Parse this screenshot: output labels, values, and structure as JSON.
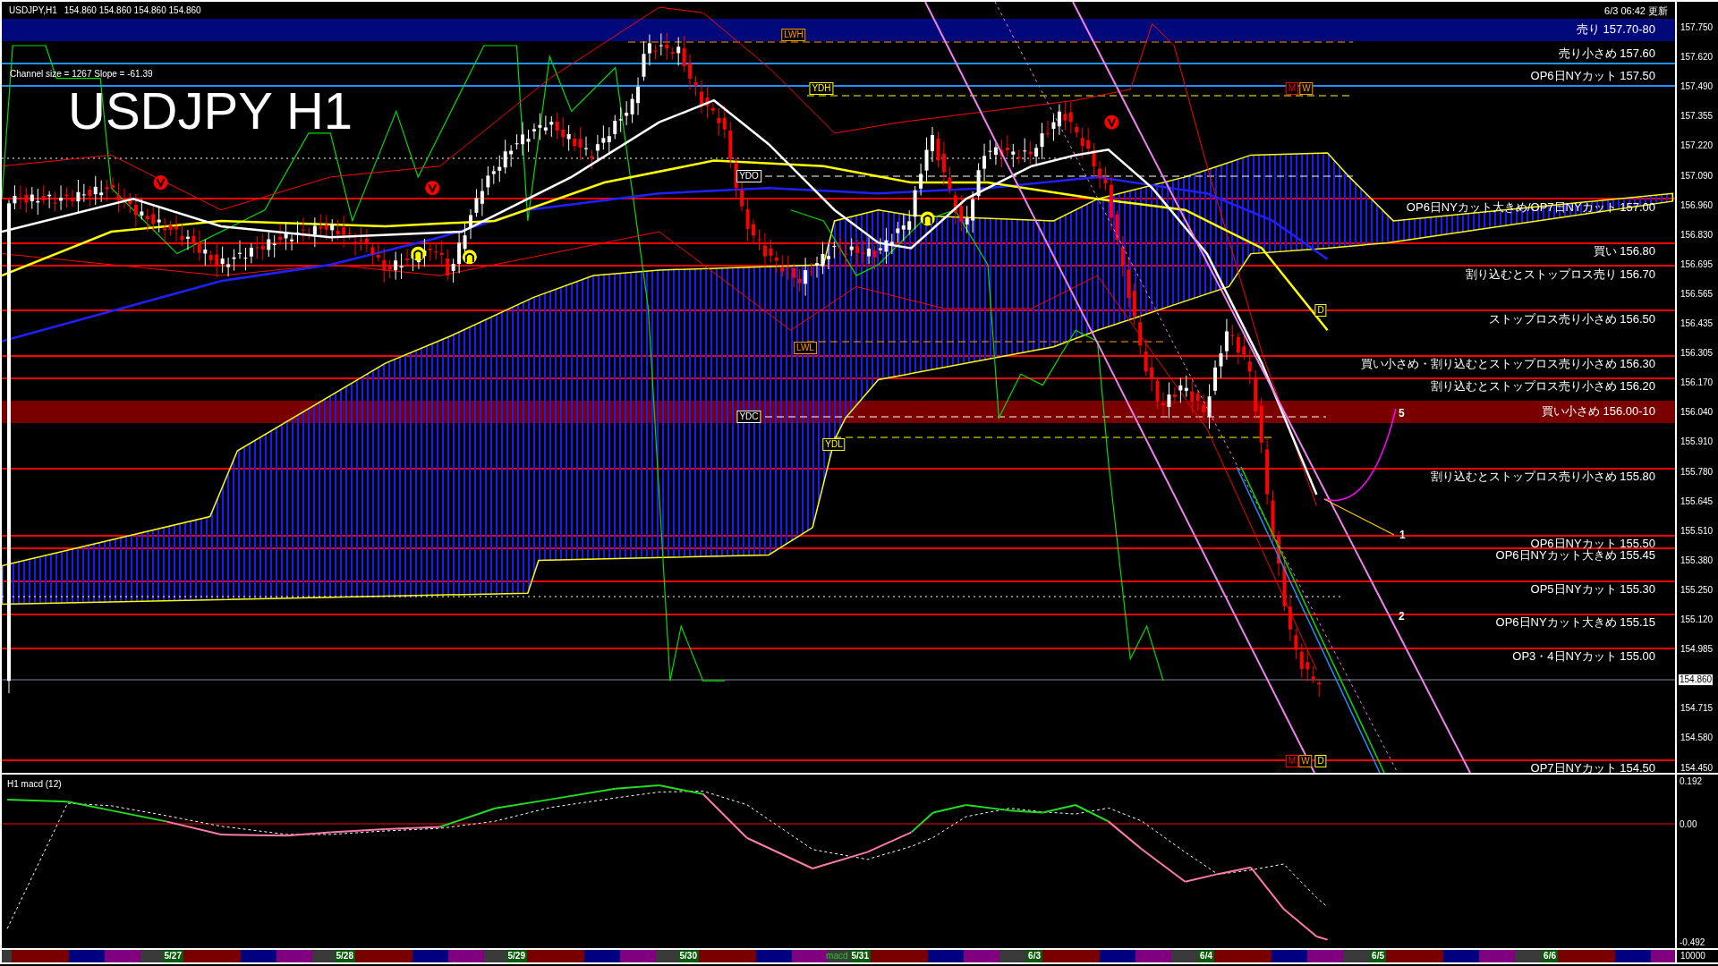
{
  "header": {
    "symbol": "USDJPY,H1",
    "prices": "154.860 154.860 154.860 154.860"
  },
  "updated": "6/3 06:42 更新",
  "channel_info": "Channel size = 1267 Slope = -61.39",
  "title": "USDJPY H1",
  "levels": [
    {
      "label": "売り 157.70-80",
      "kind": "band",
      "color": "#00087a"
    },
    {
      "label": "売り小さめ 157.60",
      "kind": "line",
      "color": "#1e90ff"
    },
    {
      "label": "OP6日NYカット 157.50",
      "kind": "line",
      "color": "#1e90ff"
    },
    {
      "label": "OP6日NYカット大きめ/OP7日NYカット 157.00",
      "kind": "line",
      "color": "#ff0000"
    },
    {
      "label": "買い 156.80",
      "kind": "line",
      "color": "#ff0000"
    },
    {
      "label": "割り込むとストップロス売り 156.70",
      "kind": "line",
      "color": "#ff0000"
    },
    {
      "label": "ストップロス売り小さめ 156.50",
      "kind": "line",
      "color": "#ff0000"
    },
    {
      "label": "買い小さめ・割り込むとストップロス売り小さめ 156.30",
      "kind": "line",
      "color": "#ff0000"
    },
    {
      "label": "割り込むとストップロス売り小さめ 156.20",
      "kind": "line",
      "color": "#ff0000"
    },
    {
      "label": "買い小さめ 156.00-10",
      "kind": "band",
      "color": "#7a0000"
    },
    {
      "label": "割り込むとストップロス売り小さめ 155.80",
      "kind": "line",
      "color": "#ff0000"
    },
    {
      "label": "OP6日NYカット 155.50",
      "kind": "line",
      "color": "#ff0000"
    },
    {
      "label": "OP6日NYカット大きめ 155.45",
      "kind": "line",
      "color": "#ff0000"
    },
    {
      "label": "OP5日NYカット 155.30",
      "kind": "line",
      "color": "#ff0000"
    },
    {
      "label": "OP6日NYカット大きめ 155.15",
      "kind": "line",
      "color": "#ff0000"
    },
    {
      "label": "OP3・4日NYカット 155.00",
      "kind": "line",
      "color": "#ff0000"
    },
    {
      "label": "OP7日NYカット 154.50",
      "kind": "line",
      "color": "#ff0000"
    }
  ],
  "markers": [
    {
      "label": "LWH",
      "color": "#ff9900"
    },
    {
      "label": "YDH",
      "color": "#ffff00"
    },
    {
      "label": "YDO",
      "color": "#ffffff"
    },
    {
      "label": "LWL",
      "color": "#ff9900"
    },
    {
      "label": "YDC",
      "color": "#ffffff"
    },
    {
      "label": "YDL",
      "color": "#ffff00"
    },
    {
      "label": "M",
      "color": "#ff0000"
    },
    {
      "label": "W",
      "color": "#ff9900"
    },
    {
      "label": "D",
      "color": "#ffff00"
    },
    {
      "label": "M",
      "color": "#ff0000"
    },
    {
      "label": "W",
      "color": "#ff9900"
    },
    {
      "label": "D",
      "color": "#ffff00"
    }
  ],
  "wave_numbers": [
    "5",
    "1",
    "2"
  ],
  "price_axis": {
    "ticks": [
      "157.750",
      "157.620",
      "157.490",
      "157.355",
      "157.220",
      "157.090",
      "156.960",
      "156.830",
      "156.695",
      "156.565",
      "156.435",
      "156.305",
      "156.170",
      "156.040",
      "155.910",
      "155.780",
      "155.645",
      "155.510",
      "155.380",
      "155.250",
      "155.120",
      "154.985",
      "154.715",
      "154.580",
      "154.450"
    ],
    "current": "154.860"
  },
  "macd": {
    "title": "H1 macd (12)",
    "ticks": [
      "0.192",
      "0.00",
      "-0.492"
    ]
  },
  "date_bar": {
    "days": [
      {
        "date": "5/27"
      },
      {
        "date": "5/28"
      },
      {
        "date": "5/29"
      },
      {
        "date": "5/30"
      },
      {
        "date": "5/31",
        "note": "macd"
      },
      {
        "date": "6/3"
      },
      {
        "date": "6/4"
      },
      {
        "date": "6/5"
      },
      {
        "date": "6/6"
      }
    ],
    "volume": "10000"
  }
}
